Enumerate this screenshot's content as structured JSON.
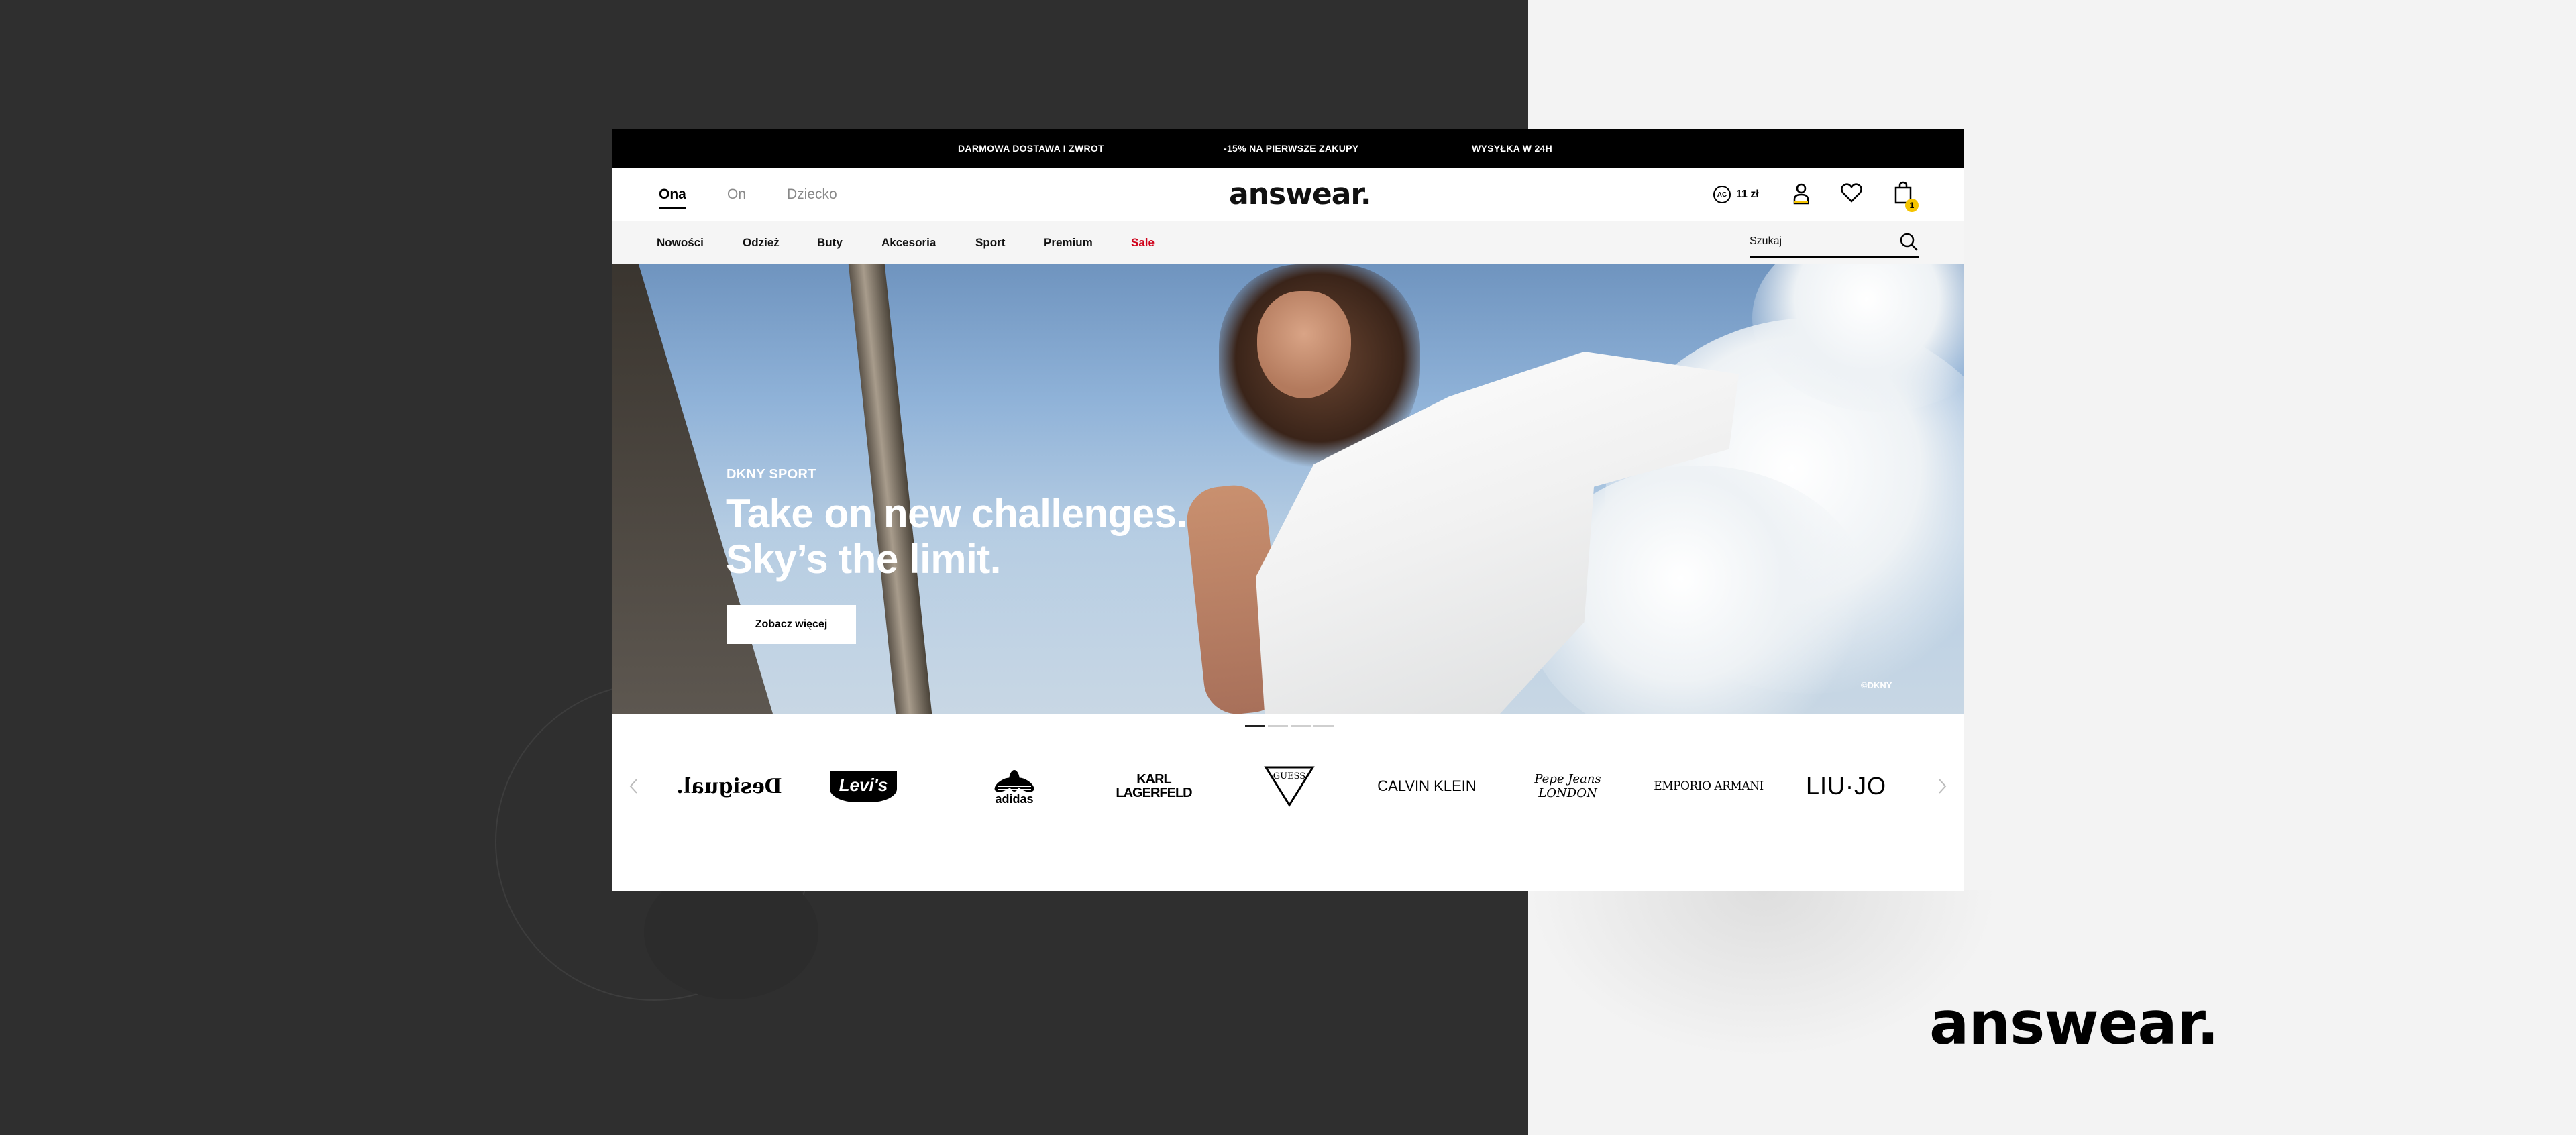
{
  "topbar": {
    "items": [
      "DARMOWA DOSTAWA I ZWROT",
      "-15% NA PIERWSZE ZAKUPY",
      "WYSYŁKA W 24H"
    ]
  },
  "header": {
    "genders": [
      "Ona",
      "On",
      "Dziecko"
    ],
    "active_gender": "Ona",
    "logo": "answear.",
    "wallet_badge": "AC",
    "wallet_amount": "11 zł",
    "cart_count": "1"
  },
  "nav": {
    "items": [
      "Nowości",
      "Odzież",
      "Buty",
      "Akcesoria",
      "Sport",
      "Premium",
      "Sale"
    ],
    "search_placeholder": "Szukaj"
  },
  "hero": {
    "brand": "DKNY SPORT",
    "title_line1": "Take on new challenges.",
    "title_line2": "Sky’s the limit.",
    "button": "Zobacz więcej",
    "credit": "©DKNY",
    "slides_total": 4,
    "active_slide": 1
  },
  "brands": {
    "items": [
      "Desigual.",
      "Levi's",
      "adidas",
      "KARL LAGERFELD",
      "GUESS",
      "CALVIN KLEIN",
      "Pepe Jeans LONDON",
      "EMPORIO ARMANI",
      "LIU·JO"
    ]
  },
  "footer_logo": "answear.",
  "colors": {
    "sale": "#d0021b",
    "cart_badge": "#f5c400",
    "topbar_bg": "#000000",
    "left_bg": "#2f2f2f",
    "right_bg": "#f3f3f3"
  }
}
